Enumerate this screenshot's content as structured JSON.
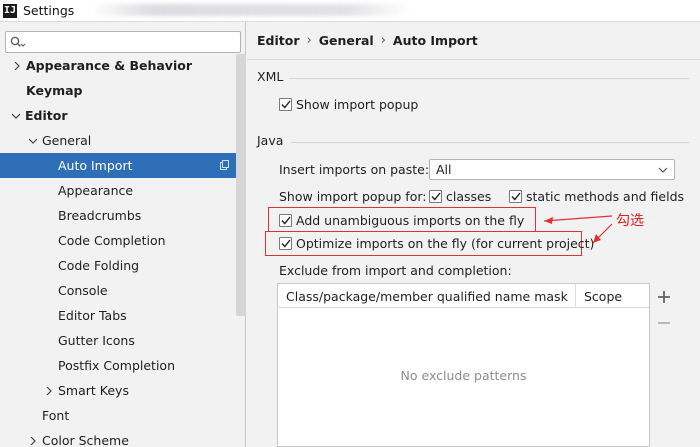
{
  "window": {
    "title": "Settings",
    "app_icon": "IJ"
  },
  "search": {
    "placeholder": ""
  },
  "sidebar": {
    "items": [
      {
        "label": "Appearance & Behavior"
      },
      {
        "label": "Keymap"
      },
      {
        "label": "Editor"
      },
      {
        "label": "General"
      },
      {
        "label": "Auto Import"
      },
      {
        "label": "Appearance"
      },
      {
        "label": "Breadcrumbs"
      },
      {
        "label": "Code Completion"
      },
      {
        "label": "Code Folding"
      },
      {
        "label": "Console"
      },
      {
        "label": "Editor Tabs"
      },
      {
        "label": "Gutter Icons"
      },
      {
        "label": "Postfix Completion"
      },
      {
        "label": "Smart Keys"
      },
      {
        "label": "Font"
      },
      {
        "label": "Color Scheme"
      }
    ]
  },
  "breadcrumb": {
    "items": [
      "Editor",
      "General",
      "Auto Import"
    ],
    "separator": "›"
  },
  "xml": {
    "section_title": "XML",
    "show_import_popup": {
      "label": "Show import popup",
      "checked": true
    }
  },
  "java": {
    "section_title": "Java",
    "insert_imports_label": "Insert imports on paste:",
    "insert_imports_value": "All",
    "show_popup_for_label": "Show import popup for:",
    "classes": {
      "label": "classes",
      "checked": true
    },
    "static_methods": {
      "label": "static methods and fields",
      "checked": true
    },
    "add_unambiguous": {
      "label": "Add unambiguous imports on the fly",
      "checked": true
    },
    "optimize_imports": {
      "label": "Optimize imports on the fly (for current project)",
      "checked": true
    },
    "exclude_label": "Exclude from import and completion:",
    "table": {
      "columns": [
        "Class/package/member qualified name mask",
        "Scope"
      ],
      "empty_text": "No exclude patterns"
    }
  },
  "annotation": {
    "text": "勾选",
    "color": "#e02020"
  },
  "colors": {
    "selection": "#2f6fb7",
    "highlight": "#e03232"
  }
}
